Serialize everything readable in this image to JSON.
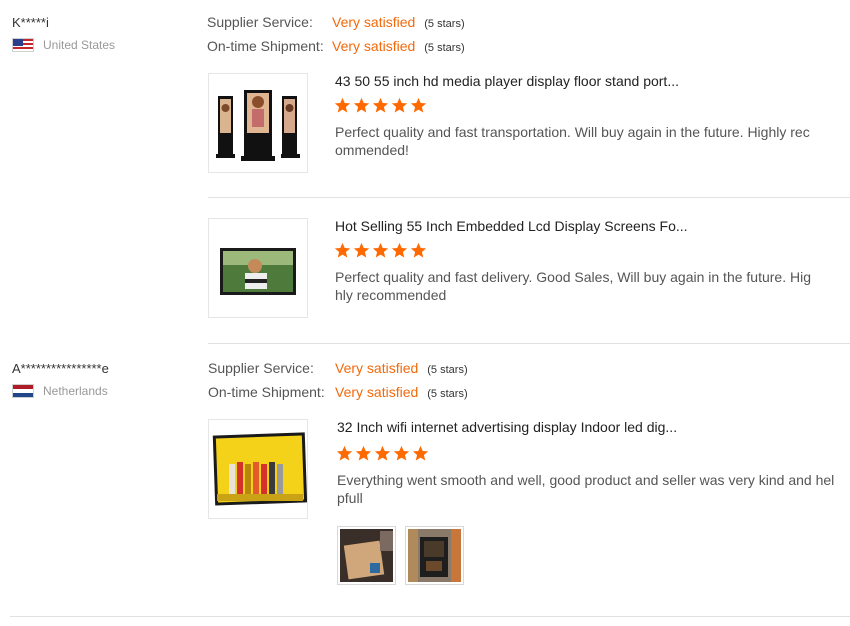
{
  "reviews": [
    {
      "buyer": "K*****i",
      "country": "United States",
      "supplier_service": {
        "label": "Supplier Service:",
        "value": "Very satisfied",
        "stars_text": "(5 stars)"
      },
      "on_time_shipment": {
        "label": "On-time Shipment:",
        "value": "Very satisfied",
        "stars_text": "(5 stars)"
      },
      "products": [
        {
          "title": "43 50 55 inch hd media player display floor stand port...",
          "rating": 5,
          "comment": "Perfect quality and fast transportation.  Will buy again in the future. Highly recommended!"
        },
        {
          "title": "Hot Selling 55 Inch Embedded Lcd Display Screens Fo...",
          "rating": 5,
          "comment": "Perfect quality and fast delivery. Good Sales, Will buy again in the future.  Highly recommended"
        }
      ]
    },
    {
      "buyer": "A****************e",
      "country": "Netherlands",
      "supplier_service": {
        "label": "Supplier Service:",
        "value": "Very satisfied",
        "stars_text": "(5 stars)"
      },
      "on_time_shipment": {
        "label": "On-time Shipment:",
        "value": "Very satisfied",
        "stars_text": "(5 stars)"
      },
      "products": [
        {
          "title": "32 Inch wifi internet advertising display Indoor led dig...",
          "rating": 5,
          "comment": "Everything went smooth and well, good product and seller was very kind and helpfull"
        }
      ]
    }
  ],
  "colors": {
    "accent": "#f2690c",
    "star": "#ff6a00"
  },
  "icons": [
    "flag-us-icon",
    "flag-nl-icon",
    "star-icon"
  ]
}
